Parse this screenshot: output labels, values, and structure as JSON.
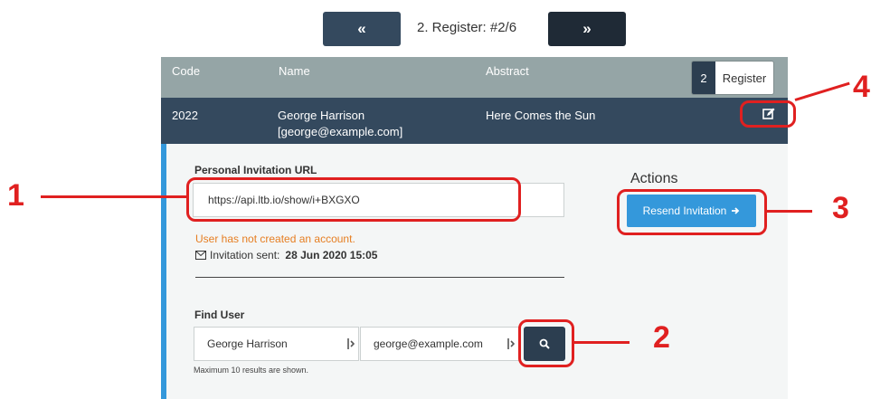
{
  "nav": {
    "prev_label": "«",
    "next_label": "»",
    "title": "2. Register:  #2/6"
  },
  "table": {
    "headers": {
      "code": "Code",
      "name": "Name",
      "abstract": "Abstract"
    },
    "register_count": "2",
    "register_label": "Register",
    "row": {
      "code": "2022",
      "name": "George Harrison",
      "email": "[george@example.com]",
      "abstract": "Here Comes the Sun"
    }
  },
  "invitation": {
    "label": "Personal Invitation URL",
    "url": "https://api.ltb.io/show/i+BXGXO",
    "warning": "User has not created an account.",
    "sent_label": "Invitation sent:",
    "sent_date": "28 Jun 2020 15:05"
  },
  "actions": {
    "title": "Actions",
    "resend_label": "Resend Invitation"
  },
  "find_user": {
    "label": "Find User",
    "name_value": "George Harrison",
    "email_value": "george@example.com",
    "hint": "Maximum 10 results are shown."
  },
  "callouts": {
    "n1": "1",
    "n2": "2",
    "n3": "3",
    "n4": "4"
  },
  "colors": {
    "accent": "#3498db",
    "dark": "#2c3e50",
    "warning": "#e67e22",
    "callout": "#e02020"
  }
}
